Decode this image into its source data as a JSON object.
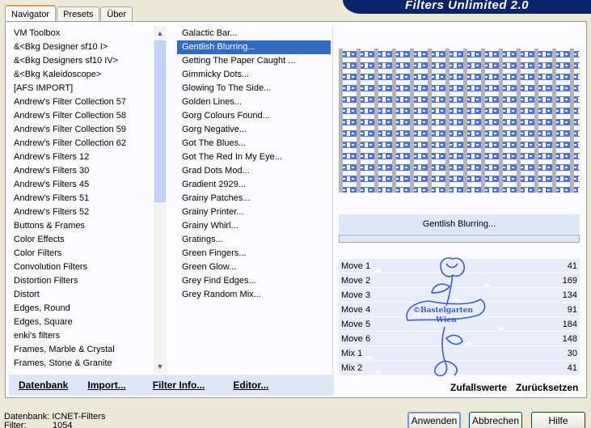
{
  "tabs": [
    "Navigator",
    "Presets",
    "Über"
  ],
  "app_title": "Filters Unlimited 2.0",
  "categories": [
    "VM Toolbox",
    "&<Bkg Designer sf10 I>",
    "&<Bkg Designers sf10 IV>",
    "&<Bkg Kaleidoscope>",
    "[AFS IMPORT]",
    "Andrew's Filter Collection 57",
    "Andrew's Filter Collection 58",
    "Andrew's Filter Collection 59",
    "Andrew's Filter Collection 62",
    "Andrew's Filters 12",
    "Andrew's Filters 30",
    "Andrew's Filters 45",
    "Andrew's Filters 51",
    "Andrew's Filters 52",
    "Buttons & Frames",
    "Color Effects",
    "Color Filters",
    "Convolution Filters",
    "Distortion Filters",
    "Distort",
    "Edges, Round",
    "Edges, Square",
    "enki's filters",
    "Frames, Marble & Crystal",
    "Frames, Stone & Granite"
  ],
  "filters": [
    "Galactic Bar...",
    "Gentlish Blurring...",
    "Getting The Paper Caught ...",
    "Gimmicky Dots...",
    "Glowing To The Side...",
    "Golden Lines...",
    "Gorg Colours Found...",
    "Gorg Negative...",
    "Got The Blues...",
    "Got The Red In My Eye...",
    "Grad Dots Mod...",
    "Gradient 2929...",
    "Grainy Patches...",
    "Grainy Printer...",
    "Grainy Whirl...",
    "Gratings...",
    "Green Fingers...",
    "Green Glow...",
    "Grey Find Edges...",
    "Grey Random Mix..."
  ],
  "selected_filter": "Gentlish Blurring...",
  "bottom_buttons": {
    "datenbank": "Datenbank",
    "import": "Import...",
    "filter_info": "Filter Info...",
    "editor": "Editor..."
  },
  "params": [
    {
      "name": "Move 1",
      "value": "41"
    },
    {
      "name": "Move 2",
      "value": "169"
    },
    {
      "name": "Move 3",
      "value": "134"
    },
    {
      "name": "Move 4",
      "value": "91"
    },
    {
      "name": "Move 5",
      "value": "184"
    },
    {
      "name": "Move 6",
      "value": "148"
    },
    {
      "name": "Mix 1",
      "value": "30"
    },
    {
      "name": "Mix 2",
      "value": "41"
    }
  ],
  "random_buttons": {
    "random": "Zufallswerte",
    "reset": "Zurücksetzen"
  },
  "status": {
    "database": "Datenbank: ICNET-Filters",
    "filter_label": "Filter:",
    "filter_count": "1054"
  },
  "dialog_buttons": {
    "apply": "Anwenden",
    "cancel": "Abbrechen",
    "help": "Hilfe"
  },
  "watermark_text": [
    "©Bastelgarten",
    "Wien"
  ],
  "colors": {
    "accent": "#316ac5",
    "banner": "#0a246a",
    "preview_blue": "#4f74e0",
    "preview_grey": "#b4b4b4"
  }
}
